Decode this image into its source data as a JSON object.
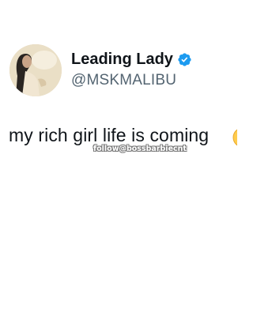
{
  "author": {
    "display_name": "Leading Lady",
    "handle": "@MSKMALIBU",
    "verified": true,
    "verified_color": "#1d9bf0"
  },
  "tweet": {
    "text": "my rich girl life is coming",
    "trailing_emoji": "face-emoji"
  },
  "watermark": {
    "text": "follow@bossbarbiecnt"
  },
  "colors": {
    "name_text": "#0f1419",
    "handle_text": "#536471",
    "background": "#ffffff"
  }
}
